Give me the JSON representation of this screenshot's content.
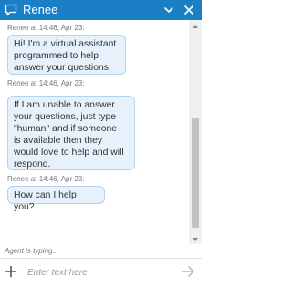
{
  "header": {
    "agent_name": "Renee",
    "chat_icon": "chat-bubble-icon",
    "minimize_icon": "minimize-icon",
    "close_icon": "close-icon",
    "color": "#1b7fc6"
  },
  "messages": [
    {
      "meta": "Renee at 14:46, Apr 23:",
      "text": "Hi! I'm a virtual assistant\nprogrammed to help\nanswer your questions."
    },
    {
      "meta": "Renee at 14:46, Apr 23:",
      "text": "If I am unable to answer\nyour questions, just type\n\"human\" and if someone\nis available then they\nwould love to help and will\nrespond."
    },
    {
      "meta": "Renee at 14:46, Apr 23:",
      "text": "How can I help you?"
    }
  ],
  "status": {
    "typing": "Agent is typing..."
  },
  "composer": {
    "placeholder": "Enter text here",
    "value": "",
    "add_icon": "plus-icon",
    "send_icon": "send-arrow-icon"
  },
  "bubble_color": "#e6f1fb"
}
